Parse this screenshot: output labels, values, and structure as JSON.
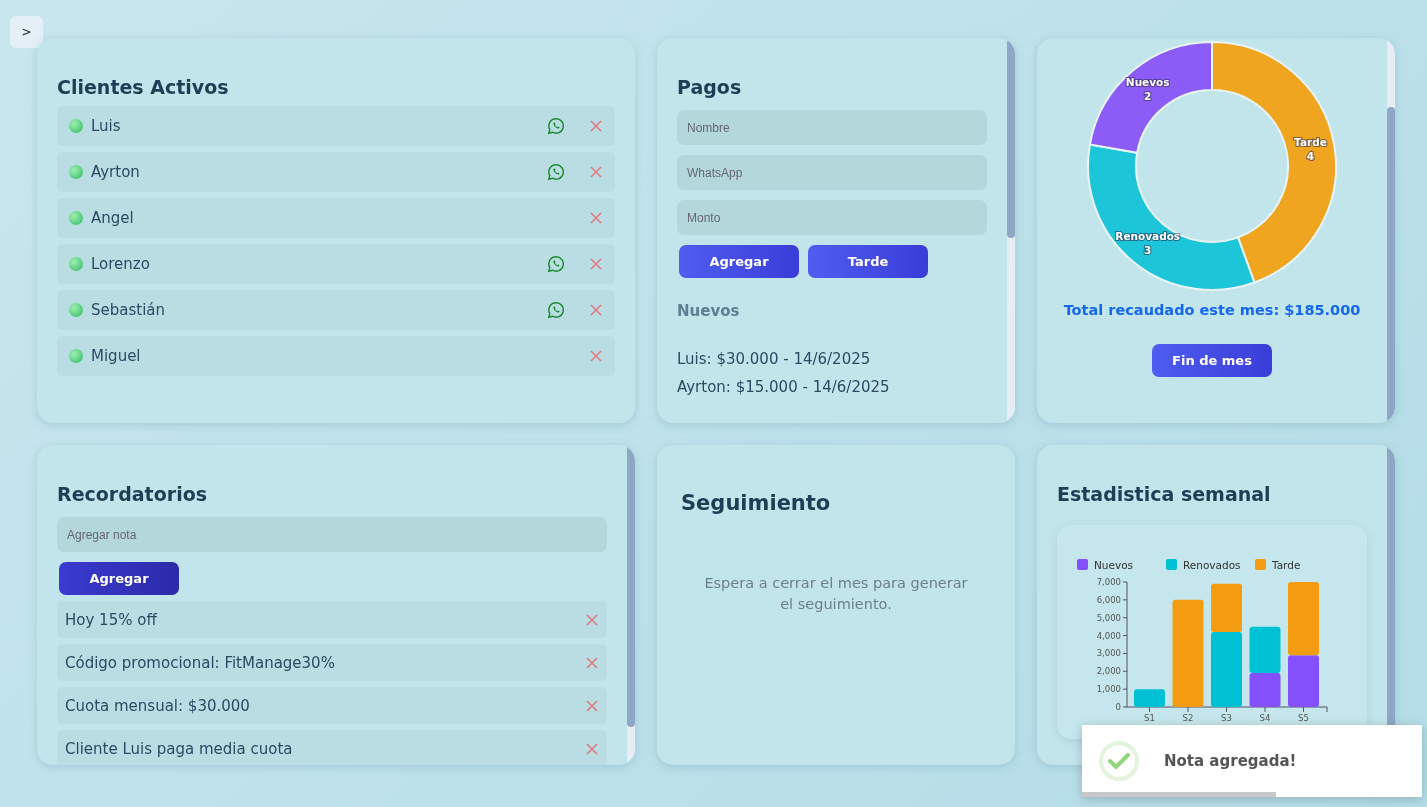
{
  "toggle_button": ">",
  "clientes": {
    "title": "Clientes Activos",
    "items": [
      {
        "name": "Luis",
        "whatsapp": true
      },
      {
        "name": "Ayrton",
        "whatsapp": true
      },
      {
        "name": "Angel",
        "whatsapp": false
      },
      {
        "name": "Lorenzo",
        "whatsapp": true
      },
      {
        "name": "Sebastián",
        "whatsapp": true
      },
      {
        "name": "Miguel",
        "whatsapp": false
      }
    ]
  },
  "pagos": {
    "title": "Pagos",
    "fields": [
      {
        "placeholder": "Nombre"
      },
      {
        "placeholder": "WhatsApp"
      },
      {
        "placeholder": "Monto"
      }
    ],
    "buttons": [
      "Agregar",
      "Tarde"
    ],
    "section": "Nuevos",
    "entries": [
      "Luis: $30.000 - 14/6/2025",
      "Ayrton: $15.000 - 14/6/2025"
    ]
  },
  "resumen": {
    "chart_data": {
      "type": "donut",
      "categories": [
        "Tarde",
        "Renovados",
        "Nuevos"
      ],
      "values": [
        4,
        3,
        2
      ],
      "colors": [
        "#f0a520",
        "#1cc6d8",
        "#8b5cf6"
      ],
      "data_labels": true
    },
    "total": "Total recaudado este mes: $185.000",
    "button": "Fin de mes"
  },
  "recordatorios": {
    "title": "Recordatorios",
    "field": {
      "placeholder": "Agregar nota"
    },
    "button": "Agregar",
    "notes": [
      "Hoy 15% off",
      "Código promocional: FitManage30%",
      "Cuota mensual: $30.000",
      "Cliente Luis paga media cuota"
    ]
  },
  "seguimiento": {
    "title": "Seguimiento",
    "message": "Espera a cerrar el mes para generar el seguimiento."
  },
  "estadistica": {
    "title": "Estadistica semanal",
    "chart_data": {
      "type": "bar",
      "stacked": true,
      "categories": [
        "S1",
        "S2",
        "S3",
        "S4",
        "S5"
      ],
      "legend": "top",
      "ylim": [
        0,
        7
      ],
      "yticks": [
        {
          "value": 0,
          "label": "0"
        },
        {
          "value": 1,
          "label": "1,000"
        },
        {
          "value": 2,
          "label": "2,000"
        },
        {
          "value": 3,
          "label": "3,000"
        },
        {
          "value": 4,
          "label": "4,000"
        },
        {
          "value": 5,
          "label": "5,000"
        },
        {
          "value": 6,
          "label": "6,000"
        },
        {
          "value": 7,
          "label": "7,000"
        }
      ],
      "series": [
        {
          "name": "Nuevos",
          "color": "#8350fb",
          "values": [
            null,
            null,
            null,
            1.9,
            2.9
          ]
        },
        {
          "name": "Renovados",
          "color": "#00c1d4",
          "values": [
            1,
            null,
            4.2,
            2.6,
            null
          ]
        },
        {
          "name": "Tarde",
          "color": "#f39c12",
          "values": [
            null,
            6,
            2.7,
            null,
            4.1
          ]
        }
      ]
    }
  },
  "toast": {
    "message": "Nota agregada!",
    "level": 0.57
  }
}
